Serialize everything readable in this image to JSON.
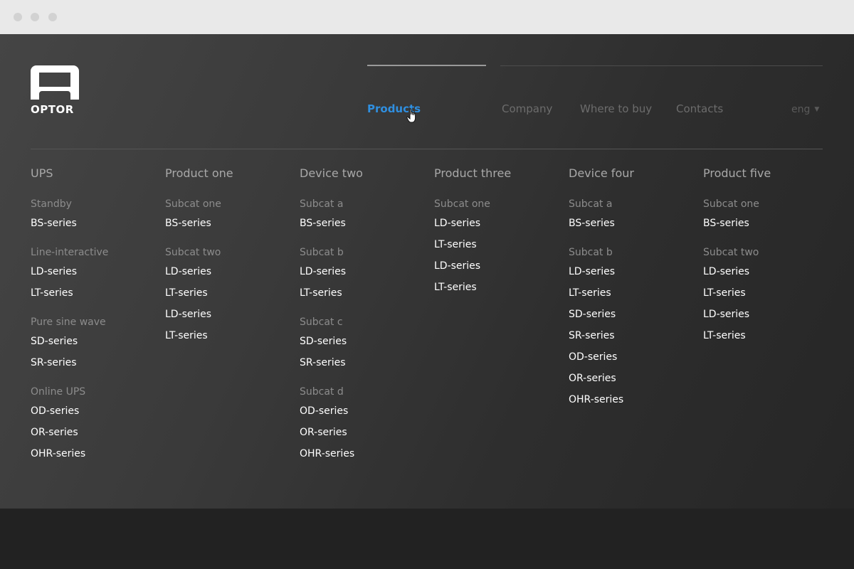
{
  "brand": {
    "name": "OPTOR"
  },
  "nav": {
    "items": [
      {
        "label": "Products",
        "active": true
      },
      {
        "label": "Company",
        "active": false
      },
      {
        "label": "Where to buy",
        "active": false
      },
      {
        "label": "Contacts",
        "active": false
      }
    ],
    "lang": "eng"
  },
  "colors": {
    "accent": "#2f8fe0",
    "background": "#333333"
  },
  "menu": {
    "columns": [
      {
        "title": "UPS",
        "groups": [
          {
            "sub": "Standby",
            "items": [
              "BS-series"
            ]
          },
          {
            "sub": "Line-interactive",
            "items": [
              "LD-series",
              "LT-series"
            ]
          },
          {
            "sub": "Pure sine wave",
            "items": [
              "SD-series",
              "SR-series"
            ]
          },
          {
            "sub": "Online UPS",
            "items": [
              "OD-series",
              "OR-series",
              "OHR-series"
            ]
          }
        ]
      },
      {
        "title": "Product one",
        "groups": [
          {
            "sub": "Subcat one",
            "items": [
              "BS-series"
            ]
          },
          {
            "sub": "Subcat two",
            "items": [
              "LD-series",
              "LT-series",
              "LD-series",
              "LT-series"
            ]
          }
        ]
      },
      {
        "title": "Device two",
        "groups": [
          {
            "sub": "Subcat a",
            "items": [
              "BS-series"
            ]
          },
          {
            "sub": "Subcat b",
            "items": [
              "LD-series",
              "LT-series"
            ]
          },
          {
            "sub": "Subcat c",
            "items": [
              "SD-series",
              "SR-series"
            ]
          },
          {
            "sub": "Subcat d",
            "items": [
              "OD-series",
              "OR-series",
              "OHR-series"
            ]
          }
        ]
      },
      {
        "title": "Product three",
        "groups": [
          {
            "sub": "Subcat one",
            "items": [
              "LD-series",
              "LT-series",
              "LD-series",
              "LT-series"
            ]
          }
        ]
      },
      {
        "title": "Device four",
        "groups": [
          {
            "sub": "Subcat a",
            "items": [
              "BS-series"
            ]
          },
          {
            "sub": "Subcat b",
            "items": [
              "LD-series",
              "LT-series",
              "SD-series",
              "SR-series",
              "OD-series",
              "OR-series",
              "OHR-series"
            ]
          }
        ]
      },
      {
        "title": "Product five",
        "groups": [
          {
            "sub": "Subcat one",
            "items": [
              "BS-series"
            ]
          },
          {
            "sub": "Subcat two",
            "items": [
              "LD-series",
              "LT-series",
              "LD-series",
              "LT-series"
            ]
          }
        ]
      }
    ]
  }
}
